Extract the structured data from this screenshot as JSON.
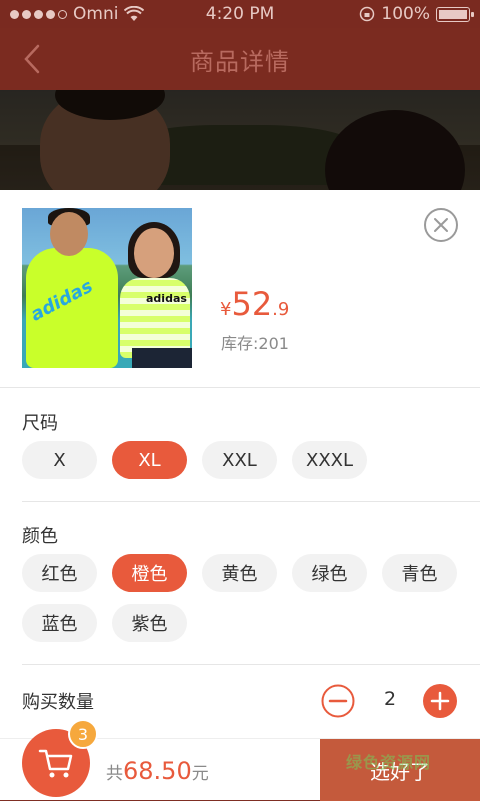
{
  "status_bar": {
    "carrier": "Omni",
    "time": "4:20 PM",
    "battery": "100%"
  },
  "header": {
    "title": "商品详情"
  },
  "product": {
    "price_symbol": "¥",
    "price_int": "52",
    "price_dec": ".9",
    "stock": "库存:201"
  },
  "size": {
    "label": "尺码",
    "options": [
      "X",
      "XL",
      "XXL",
      "XXXL"
    ],
    "selected": "XL"
  },
  "color": {
    "label": "颜色",
    "options": [
      "红色",
      "橙色",
      "黄色",
      "绿色",
      "青色",
      "蓝色",
      "紫色"
    ],
    "selected": "橙色"
  },
  "quantity": {
    "label": "购买数量",
    "value": "2"
  },
  "bottom": {
    "cart_count": "3",
    "total_prefix": "共",
    "total_amount": "68.50",
    "total_unit": "元",
    "confirm_label": "选好了",
    "watermark": "绿色资源网"
  },
  "colors": {
    "accent": "#e85a3c",
    "badge": "#f6a83d",
    "header_bg": "#7b2b20"
  }
}
